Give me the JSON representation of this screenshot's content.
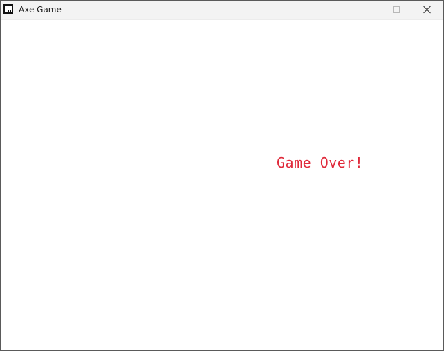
{
  "window": {
    "title": "Axe Game",
    "icon": "app-window-icon",
    "controls": {
      "minimize_icon": "minimize-icon",
      "maximize_icon": "maximize-icon",
      "close_icon": "close-icon"
    }
  },
  "game": {
    "message": "Game Over!",
    "message_color": "#e0293a",
    "background": "#ffffff"
  }
}
